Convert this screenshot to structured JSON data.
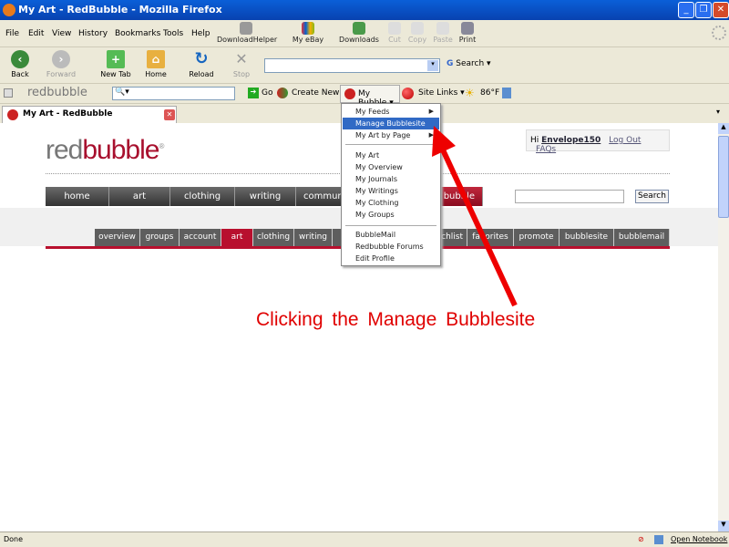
{
  "window": {
    "title": "My Art - RedBubble - Mozilla Firefox"
  },
  "menu": [
    "File",
    "Edit",
    "View",
    "History",
    "Bookmarks",
    "Tools",
    "Help"
  ],
  "toolbar": {
    "downloadhelper": "DownloadHelper",
    "myebay": "My eBay",
    "downloads": "Downloads",
    "cut": "Cut",
    "copy": "Copy",
    "paste": "Paste",
    "print": "Print"
  },
  "nav": {
    "back": "Back",
    "forward": "Forward",
    "newtab": "New Tab",
    "home": "Home",
    "reload": "Reload",
    "stop": "Stop",
    "url": "",
    "search": "Search"
  },
  "rbtoolbar": {
    "logo": "redbubble",
    "go": "Go",
    "create_new": "Create New",
    "my_bubble": "My Bubble",
    "site_links": "Site Links",
    "weather": "86°F"
  },
  "tab": {
    "label": "My Art - RedBubble"
  },
  "page": {
    "logo_red": "red",
    "logo_bubble": "bubble",
    "user": {
      "greeting": "Hi",
      "name": "Envelope150",
      "logout": "Log Out",
      "faqs": "FAQs"
    },
    "nav": [
      "home",
      "art",
      "clothing",
      "writing",
      "commun",
      "bubble"
    ],
    "search_button": "Search",
    "subnav": [
      "overview",
      "groups",
      "account",
      "art",
      "clothing",
      "writing",
      "tchlist",
      "favorites",
      "promote",
      "bubblesite",
      "bubblemail"
    ]
  },
  "dropdown": {
    "items": [
      "My Feeds",
      "Manage Bubblesite",
      "My Art by Page",
      "My Art",
      "My Overview",
      "My Journals",
      "My Writings",
      "My Clothing",
      "My Groups",
      "BubbleMail",
      "Redbubble Forums",
      "Edit Profile"
    ]
  },
  "annotation": "Clicking the Manage Bubblesite",
  "status": {
    "text": "Done",
    "notebook": "Open Notebook"
  },
  "colors": {
    "brand": "#b8102e",
    "annotation": "#e00000",
    "highlight": "#316ac5"
  }
}
